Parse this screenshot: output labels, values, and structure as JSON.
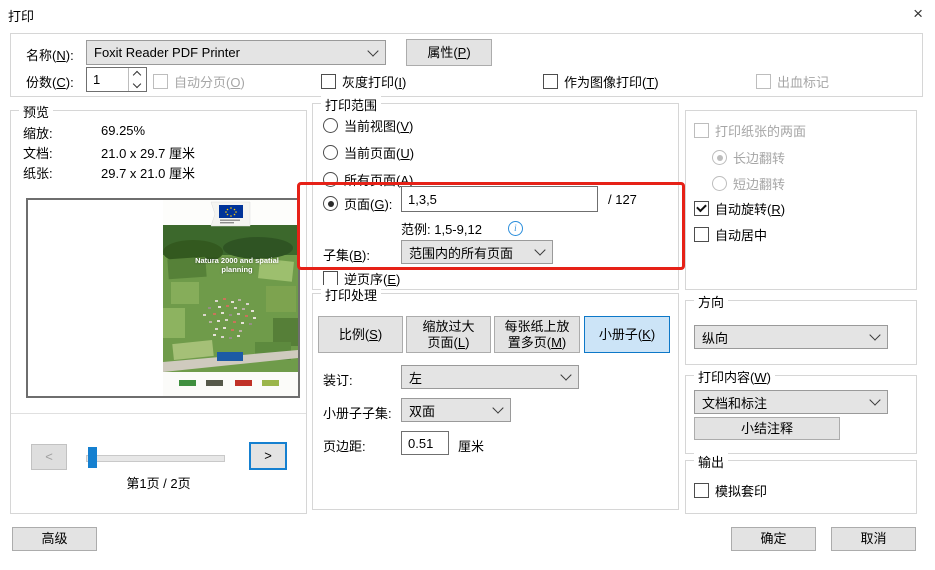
{
  "window": {
    "title": "打印",
    "close_icon": "×"
  },
  "printer": {
    "name_label": "名称(N):",
    "name_value": "Foxit Reader PDF Printer",
    "properties_button": "属性(P)",
    "copies_label": "份数(C):",
    "copies_value": "1",
    "collate_checkbox": "自动分页(O)",
    "grayscale_checkbox": "灰度打印(I)",
    "print_as_image_checkbox": "作为图像打印(T)",
    "bleed_marks_checkbox": "出血标记"
  },
  "preview": {
    "group_label": "预览",
    "zoom_label": "缩放:",
    "zoom_value": "69.25%",
    "document_label": "文档:",
    "document_value": "21.0 x 29.7 厘米",
    "paper_label": "纸张:",
    "paper_value": "29.7 x 21.0 厘米",
    "cover_title": "Natura 2000 and spatial planning",
    "prev_button": "<",
    "next_button": ">",
    "page_indicator": "第1页 / 2页"
  },
  "print_range": {
    "group_label": "打印范围",
    "option_current_view": "当前视图(V)",
    "option_current_page": "当前页面(U)",
    "option_all_pages": "所有页面(A)",
    "pages_label": "页面(G):",
    "pages_value": "1,3,5",
    "pages_total": "/ 127",
    "example_text": "范例: 1,5-9,12",
    "info_icon_glyph": "i",
    "subset_label": "子集(B):",
    "subset_value": "范围内的所有页面",
    "reverse_checkbox": "逆页序(E)"
  },
  "print_handling": {
    "group_label": "打印处理",
    "scale_button": "比例(S)",
    "shrink_line1": "缩放过大",
    "shrink_line2": "页面(L)",
    "multiple_line1": "每张纸上放",
    "multiple_line2": "置多页(M)",
    "booklet_button": "小册子(K)",
    "binding_label": "装订:",
    "binding_value": "左",
    "booklet_subset_label": "小册子子集:",
    "booklet_subset_value": "双面",
    "margin_label": "页边距:",
    "margin_value": "0.51",
    "margin_unit": "厘米"
  },
  "duplex": {
    "both_sides_checkbox": "打印纸张的两面",
    "long_edge_radio": "长边翻转",
    "short_edge_radio": "短边翻转",
    "auto_rotate_checkbox": "自动旋转(R)",
    "auto_center_checkbox": "自动居中"
  },
  "orientation": {
    "group_label": "方向",
    "value": "纵向"
  },
  "print_content": {
    "group_label": "打印内容(W)",
    "value": "文档和标注",
    "summarize_button": "小结注释"
  },
  "output": {
    "group_label": "输出",
    "simulate_checkbox": "模拟套印"
  },
  "footer": {
    "advanced_button": "高级",
    "ok_button": "确定",
    "cancel_button": "取消"
  },
  "colors": {
    "accent": "#1580d0",
    "selected_bg": "#cce4f7",
    "highlight": "#e62117"
  }
}
